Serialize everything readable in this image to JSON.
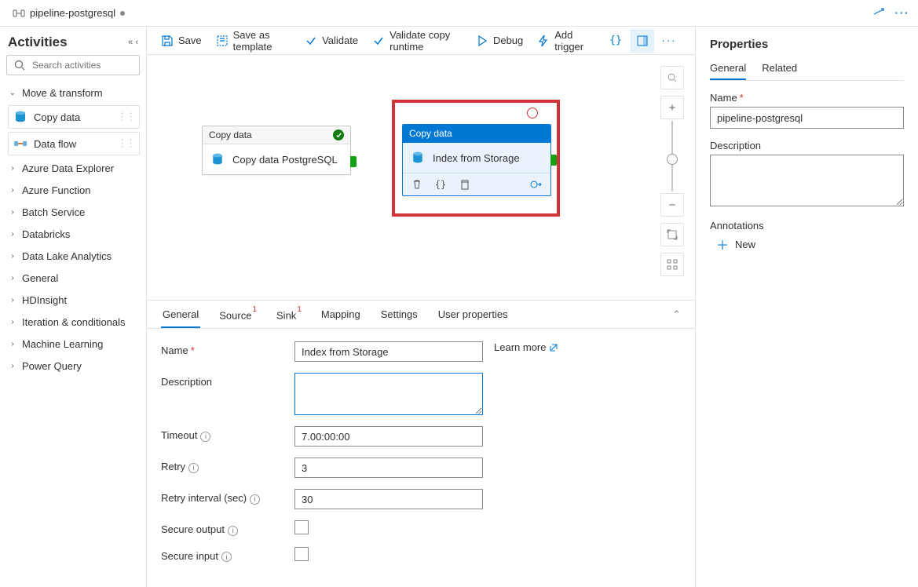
{
  "tab": {
    "icon": "pipeline",
    "title": "pipeline-postgresql",
    "dirty": true
  },
  "side": {
    "title": "Activities",
    "search_placeholder": "Search activities",
    "open_group": "Move & transform",
    "open_items": [
      {
        "label": "Copy data",
        "icon": "db"
      },
      {
        "label": "Data flow",
        "icon": "flow"
      }
    ],
    "groups": [
      "Azure Data Explorer",
      "Azure Function",
      "Batch Service",
      "Databricks",
      "Data Lake Analytics",
      "General",
      "HDInsight",
      "Iteration & conditionals",
      "Machine Learning",
      "Power Query"
    ]
  },
  "toolbar": {
    "save": "Save",
    "save_tpl": "Save as template",
    "validate": "Validate",
    "validate_copy": "Validate copy runtime",
    "debug": "Debug",
    "add_trigger": "Add trigger"
  },
  "canvas": {
    "node1": {
      "type": "Copy data",
      "name": "Copy data PostgreSQL",
      "status": "ok"
    },
    "node2": {
      "type": "Copy data",
      "name": "Index from Storage",
      "status": "invalid"
    }
  },
  "form": {
    "tabs": [
      "General",
      "Source",
      "Sink",
      "Mapping",
      "Settings",
      "User properties"
    ],
    "flags": {
      "Source": true,
      "Sink": true
    },
    "learn_more": "Learn more",
    "name_label": "Name",
    "name_value": "Index from Storage",
    "desc_label": "Description",
    "desc_value": "",
    "timeout_label": "Timeout",
    "timeout_value": "7.00:00:00",
    "retry_label": "Retry",
    "retry_value": "3",
    "retry_int_label": "Retry interval (sec)",
    "retry_int_value": "30",
    "secure_out_label": "Secure output",
    "secure_in_label": "Secure input"
  },
  "props": {
    "title": "Properties",
    "tabs": [
      "General",
      "Related"
    ],
    "name_label": "Name",
    "name_value": "pipeline-postgresql",
    "desc_label": "Description",
    "ann_label": "Annotations",
    "new_label": "New"
  }
}
